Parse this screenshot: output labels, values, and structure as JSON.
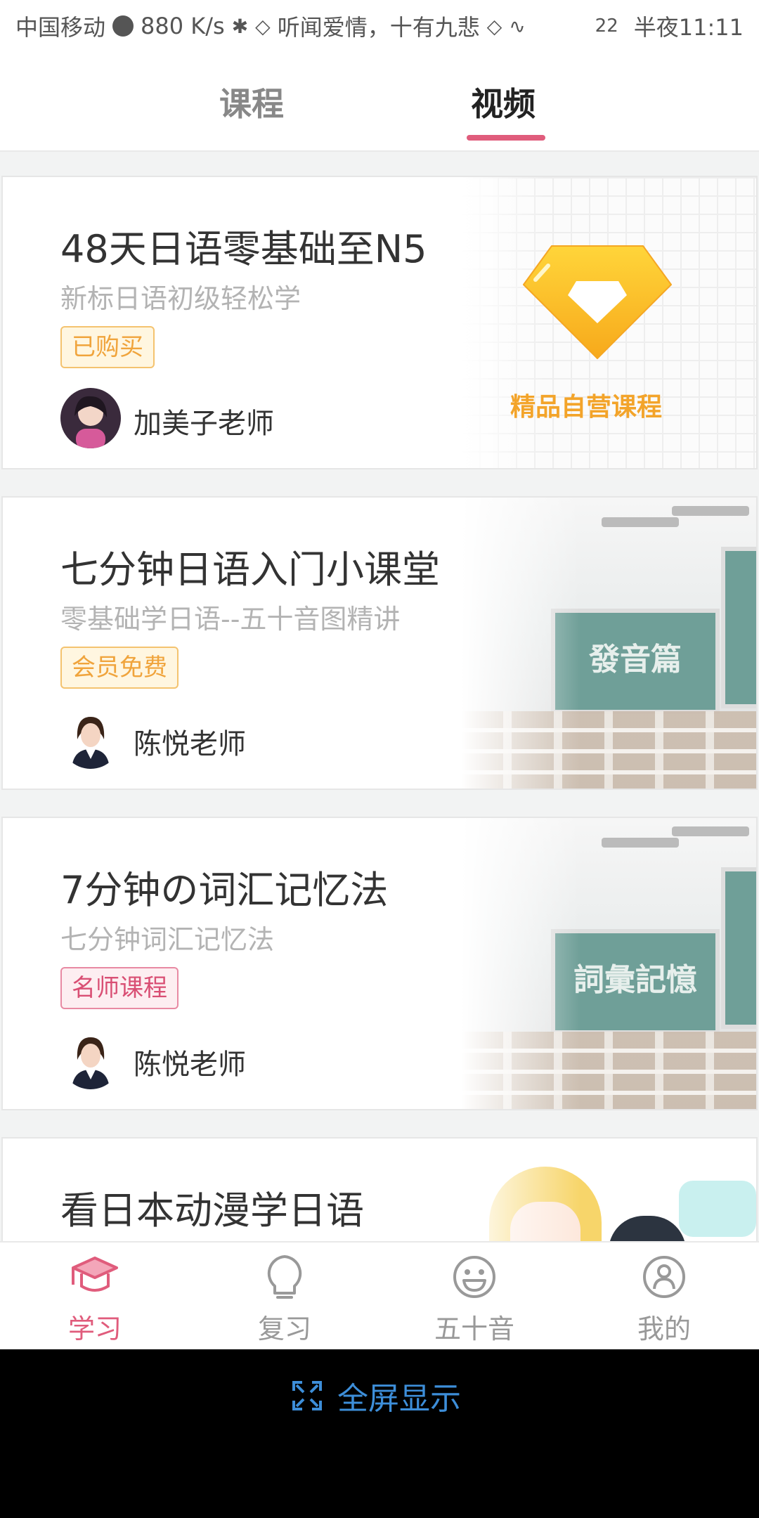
{
  "status_bar": {
    "carrier": "中国移动",
    "speed": "880 K/s",
    "music": "听闻爱情，十有九悲",
    "battery": "22",
    "time": "半夜11:11"
  },
  "tabs": [
    {
      "label": "课程",
      "active": false
    },
    {
      "label": "视频",
      "active": true
    }
  ],
  "courses": [
    {
      "title": "48天日语零基础至N5",
      "subtitle": "新标日语初级轻松学",
      "badge": "已购买",
      "badge_style": "orange",
      "teacher": "加美子老师",
      "art_label": "精品自营课程"
    },
    {
      "title": "七分钟日语入门小课堂",
      "subtitle": "零基础学日语--五十音图精讲",
      "badge": "会员免费",
      "badge_style": "orange",
      "teacher": "陈悦老师",
      "art_label": "發音篇"
    },
    {
      "title": "7分钟の词汇记忆法",
      "subtitle": "七分钟词汇记忆法",
      "badge": "名师课程",
      "badge_style": "pink",
      "teacher": "陈悦老师",
      "art_label": "詞彙記憶"
    },
    {
      "title": "看日本动漫学日语"
    }
  ],
  "bottom_nav": [
    {
      "label": "学习",
      "icon": "graduation-cap-icon",
      "active": true
    },
    {
      "label": "复习",
      "icon": "lightbulb-icon",
      "active": false
    },
    {
      "label": "五十音",
      "icon": "smiley-icon",
      "active": false
    },
    {
      "label": "我的",
      "icon": "user-icon",
      "active": false
    }
  ],
  "system_bar": {
    "fullscreen_label": "全屏显示",
    "icon": "expand-icon"
  },
  "colors": {
    "accent": "#e05c7c",
    "badge_orange": "#f0a43c",
    "badge_pink": "#d94f74",
    "premium_gold": "#f3a42a",
    "fullscreen_blue": "#3d8ed9"
  }
}
